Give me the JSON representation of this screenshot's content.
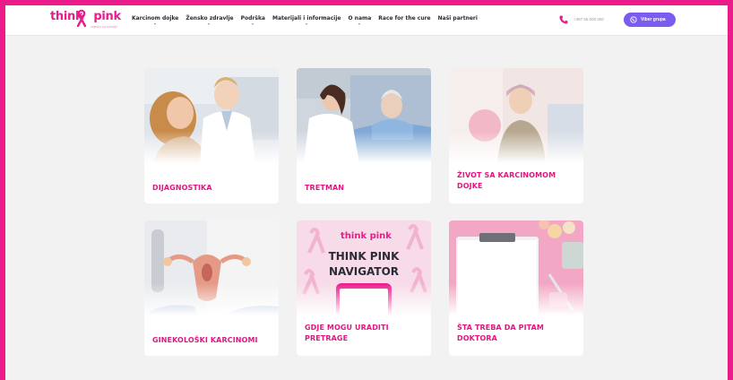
{
  "brand": {
    "logo_word_1": "think",
    "logo_word_2": "pink",
    "logo_tagline": "zajedno za zdravlje",
    "primary_color": "#ec1b8c",
    "viber_color": "#7b5cf0"
  },
  "nav": {
    "items": [
      {
        "label": "Karcinom dojke",
        "has_dropdown": true
      },
      {
        "label": "Žensko zdravlje",
        "has_dropdown": true
      },
      {
        "label": "Podrška",
        "has_dropdown": true
      },
      {
        "label": "Materijali i informacije",
        "has_dropdown": true
      },
      {
        "label": "O nama",
        "has_dropdown": true
      },
      {
        "label": "Race for the cure",
        "has_dropdown": false
      },
      {
        "label": "Naši partneri",
        "has_dropdown": false
      }
    ]
  },
  "contact": {
    "phone": "+387 66 000 000",
    "phone_icon": "phone-icon",
    "viber_label": "Viber grupa",
    "viber_icon": "viber-icon"
  },
  "cards": [
    {
      "title": "DIJAGNOSTIKA",
      "image": "doctor-patient-photo"
    },
    {
      "title": "TRETMAN",
      "image": "hospital-bed-photo"
    },
    {
      "title": "ŽIVOT SA KARCINOMOM DOJKE",
      "image": "smiling-woman-headscarf-photo"
    },
    {
      "title": "GINEKOLOŠKI KARCINOMI",
      "image": "uterus-model-photo"
    },
    {
      "title": "GDJE MOGU URADITI PRETRAGE",
      "image": "think-pink-navigator-promo",
      "promo_brand": "think pink",
      "promo_text_1": "THINK PINK",
      "promo_text_2": "NAVIGATOR"
    },
    {
      "title": "ŠTA TREBA DA PITAM DOKTORA",
      "image": "clipboard-flatlay-photo"
    }
  ]
}
